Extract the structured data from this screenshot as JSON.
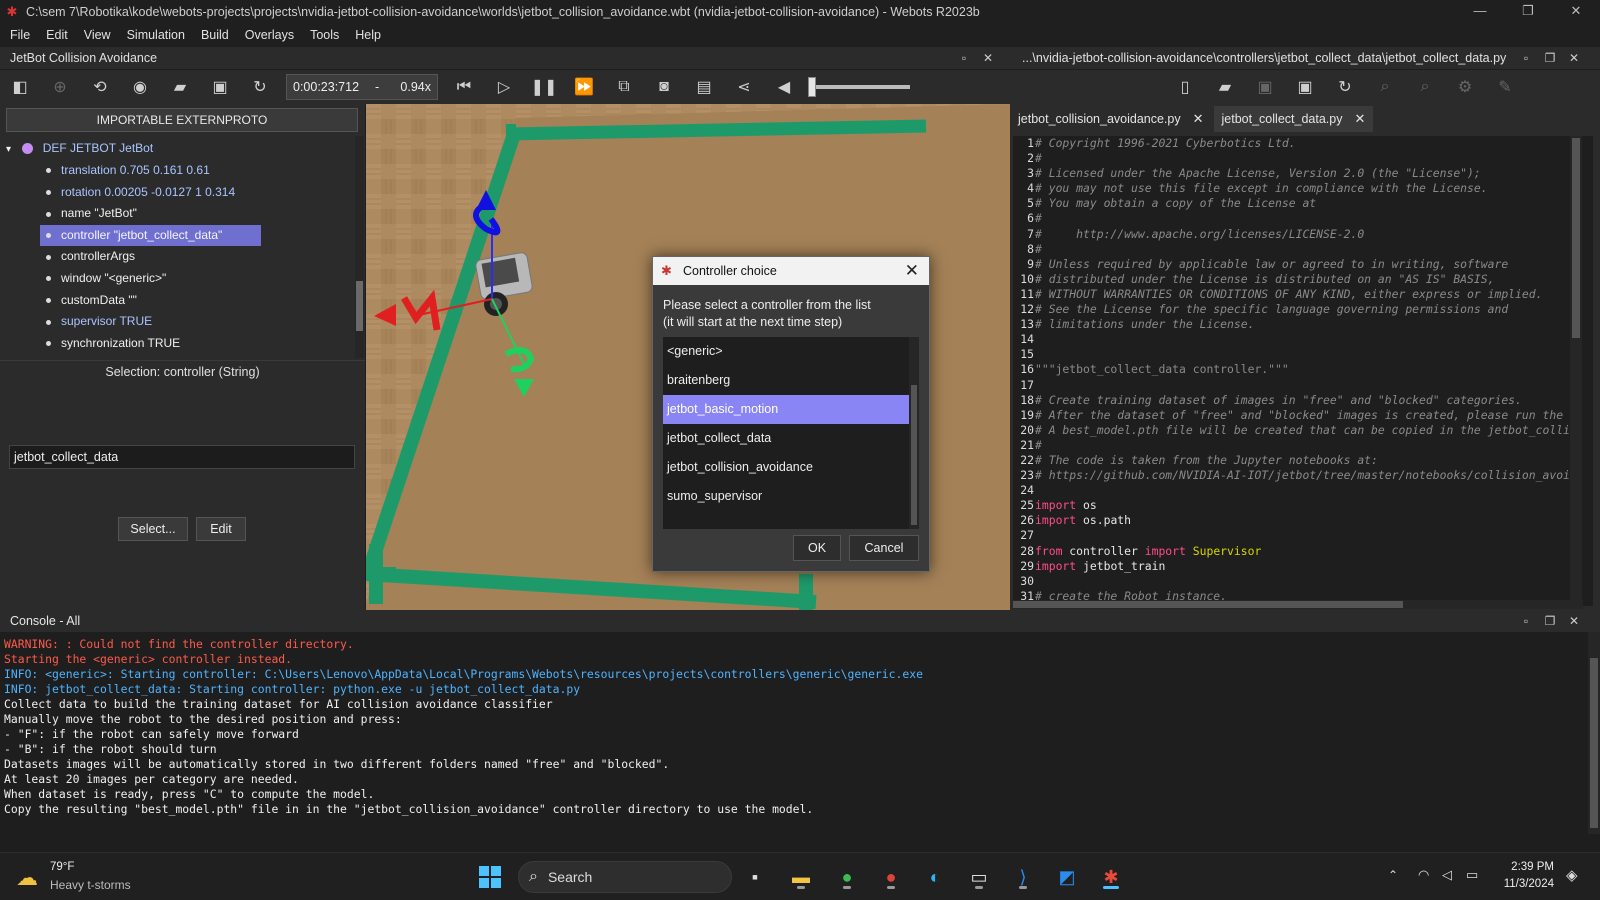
{
  "window": {
    "title": "C:\\sem 7\\Robotika\\kode\\webots-projects\\projects\\nvidia-jetbot-collision-avoidance\\worlds\\jetbot_collision_avoidance.wbt (nvidia-jetbot-collision-avoidance) - Webots R2023b"
  },
  "menu": [
    "File",
    "Edit",
    "View",
    "Simulation",
    "Build",
    "Overlays",
    "Tools",
    "Help"
  ],
  "world_panel": {
    "title": "JetBot Collision Avoidance",
    "time": "0:00:23:712",
    "speed_sep": "-",
    "speed": "0.94x"
  },
  "scene_tree": {
    "externproto_label": "IMPORTABLE EXTERNPROTO",
    "root": "DEF JETBOT JetBot",
    "root_color": "#c58cf3",
    "fields": [
      {
        "label": "translation 0.705 0.161 0.61",
        "style": "blue"
      },
      {
        "label": "rotation 0.00205 -0.0127 1 0.314",
        "style": "blue"
      },
      {
        "label": "name \"JetBot\"",
        "style": "white"
      },
      {
        "label": "controller \"jetbot_collect_data\"",
        "style": "sel"
      },
      {
        "label": "controllerArgs",
        "style": "white"
      },
      {
        "label": "window \"<generic>\"",
        "style": "white"
      },
      {
        "label": "customData \"\"",
        "style": "white"
      },
      {
        "label": "supervisor TRUE",
        "style": "blue"
      },
      {
        "label": "synchronization TRUE",
        "style": "white"
      }
    ]
  },
  "field_editor": {
    "selection_label": "Selection: controller (String)",
    "value": "jetbot_collect_data",
    "select_label": "Select...",
    "edit_label": "Edit"
  },
  "editor": {
    "title": "...\\nvidia-jetbot-collision-avoidance\\controllers\\jetbot_collect_data\\jetbot_collect_data.py",
    "tabs": [
      {
        "label": "jetbot_collision_avoidance.py",
        "active": false
      },
      {
        "label": "jetbot_collect_data.py",
        "active": true
      }
    ],
    "lines": [
      [
        {
          "t": "# Copyright 1996-2021 Cyberbotics Ltd.",
          "c": "cm"
        }
      ],
      [
        {
          "t": "#",
          "c": "cm"
        }
      ],
      [
        {
          "t": "# Licensed under the Apache License, Version 2.0 (the \"License\");",
          "c": "cm"
        }
      ],
      [
        {
          "t": "# you may not use this file except in compliance with the License.",
          "c": "cm"
        }
      ],
      [
        {
          "t": "# You may obtain a copy of the License at",
          "c": "cm"
        }
      ],
      [
        {
          "t": "#",
          "c": "cm"
        }
      ],
      [
        {
          "t": "#     http://www.apache.org/licenses/LICENSE-2.0",
          "c": "cm"
        }
      ],
      [
        {
          "t": "#",
          "c": "cm"
        }
      ],
      [
        {
          "t": "# Unless required by applicable law or agreed to in writing, software",
          "c": "cm"
        }
      ],
      [
        {
          "t": "# distributed under the License is distributed on an \"AS IS\" BASIS,",
          "c": "cm"
        }
      ],
      [
        {
          "t": "# WITHOUT WARRANTIES OR CONDITIONS OF ANY KIND, either express or implied.",
          "c": "cm"
        }
      ],
      [
        {
          "t": "# See the License for the specific language governing permissions and",
          "c": "cm"
        }
      ],
      [
        {
          "t": "# limitations under the License.",
          "c": "cm"
        }
      ],
      [],
      [],
      [
        {
          "t": "\"\"\"jetbot_collect_data controller.\"\"\"",
          "c": "st"
        }
      ],
      [],
      [
        {
          "t": "# Create training dataset of images in \"free\" and \"blocked\" categories.",
          "c": "cm"
        }
      ],
      [
        {
          "t": "# After the dataset of \"free\" and \"blocked\" images is created, please run the j",
          "c": "cm"
        }
      ],
      [
        {
          "t": "# A best_model.pth file will be created that can be copied in the jetbot_collis",
          "c": "cm"
        }
      ],
      [
        {
          "t": "#",
          "c": "cm"
        }
      ],
      [
        {
          "t": "# The code is taken from the Jupyter notebooks at:",
          "c": "cm"
        }
      ],
      [
        {
          "t": "# https://github.com/NVIDIA-AI-IOT/jetbot/tree/master/notebooks/collision_avoia",
          "c": "cm"
        }
      ],
      [],
      [
        {
          "t": "import",
          "c": "kw"
        },
        {
          "t": " os",
          "c": "tx"
        }
      ],
      [
        {
          "t": "import",
          "c": "kw"
        },
        {
          "t": " os.path",
          "c": "tx"
        }
      ],
      [],
      [
        {
          "t": "from",
          "c": "kw"
        },
        {
          "t": " controller ",
          "c": "tx"
        },
        {
          "t": "import",
          "c": "kw"
        },
        {
          "t": " Supervisor",
          "c": "cls"
        }
      ],
      [
        {
          "t": "import",
          "c": "kw"
        },
        {
          "t": " jetbot_train",
          "c": "tx"
        }
      ],
      [],
      [
        {
          "t": "# create the Robot instance.",
          "c": "cm"
        }
      ]
    ]
  },
  "console": {
    "title": "Console - All",
    "lines": [
      {
        "text": "WARNING: : Could not find the controller directory.",
        "color": "#ff5a4a"
      },
      {
        "text": "Starting the <generic> controller instead.",
        "color": "#ff5a4a"
      },
      {
        "text": "INFO: <generic>: Starting controller: C:\\Users\\Lenovo\\AppData\\Local\\Programs\\Webots\\resources\\projects\\controllers\\generic\\generic.exe",
        "color": "#4fb3ff"
      },
      {
        "text": "INFO: jetbot_collect_data: Starting controller: python.exe -u jetbot_collect_data.py",
        "color": "#4fb3ff"
      },
      {
        "text": "Collect data to build the training dataset for AI collision avoidance classifier",
        "color": "#f0f0f0"
      },
      {
        "text": "Manually move the robot to the desired position and press:",
        "color": "#f0f0f0"
      },
      {
        "text": "- \"F\": if the robot can safely move forward",
        "color": "#f0f0f0"
      },
      {
        "text": "- \"B\": if the robot should turn",
        "color": "#f0f0f0"
      },
      {
        "text": "Datasets images will be automatically stored in two different folders named \"free\" and \"blocked\".",
        "color": "#f0f0f0"
      },
      {
        "text": "At least 20 images per category are needed.",
        "color": "#f0f0f0"
      },
      {
        "text": "When dataset is ready, press \"C\" to compute the model.",
        "color": "#f0f0f0"
      },
      {
        "text": "Copy the resulting \"best_model.pth\" file in in the \"jetbot_collision_avoidance\" controller directory to use the model.",
        "color": "#f0f0f0"
      }
    ]
  },
  "dialog": {
    "title": "Controller choice",
    "message_1": "Please select a controller from the list",
    "message_2": "(it will start at the next time step)",
    "options": [
      "<generic>",
      "braitenberg",
      "jetbot_basic_motion",
      "jetbot_collect_data",
      "jetbot_collision_avoidance",
      "sumo_supervisor"
    ],
    "selected_index": 2,
    "ok_label": "OK",
    "cancel_label": "Cancel"
  },
  "taskbar": {
    "temperature": "79°F",
    "weather": "Heavy t-storms",
    "search_placeholder": "Search",
    "time": "2:39 PM",
    "date": "11/3/2024"
  },
  "colors": {
    "accent_selection": "#8a85f5",
    "tape": "#1e9a6a",
    "floor": "#a98860"
  }
}
